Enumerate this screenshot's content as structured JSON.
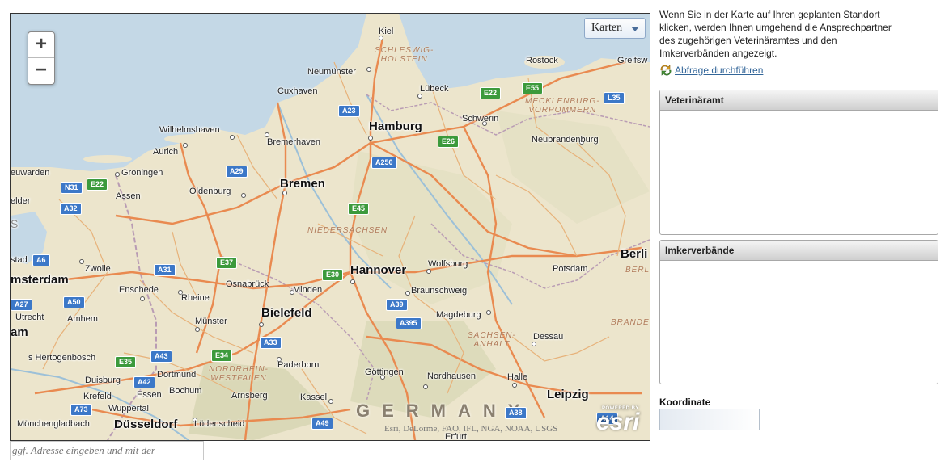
{
  "map": {
    "zoom_in": "+",
    "zoom_out": "−",
    "basemap_label": "Karten",
    "attribution": "Esri, DeLorme, FAO, IFL, NGA, NOAA, USGS",
    "logo_powered": "POWERED BY",
    "logo_name": "esri",
    "country": "GERMANY",
    "regions": [
      "SCHLESWIG-",
      "HOLSTEIN",
      "MECKLENBURG-",
      "VORPOMMERN",
      "NIEDERSACHSEN",
      "SACHSEN-",
      "ANHALT",
      "NORDRHEIN-",
      "WESTFALEN",
      "BERLIN",
      "BRANDE"
    ],
    "major_cities": [
      "Hamburg",
      "Bremen",
      "Hannover",
      "Bielefeld",
      "Düsseldorf",
      "Leipzig",
      "Berli",
      "msterdam"
    ],
    "cities": [
      "Kiel",
      "Rostock",
      "Greifsw",
      "Neumünster",
      "Lübeck",
      "Cuxhaven",
      "Schwerin",
      "Wilhelmshaven",
      "Bremerhaven",
      "Neubrandenburg",
      "Aurich",
      "euwarden",
      "Groningen",
      "Assen",
      "Oldenburg",
      "elder",
      "Zwolle",
      "Wolfsburg",
      "Potsdam",
      "Enschede",
      "Osnabrück",
      "Minden",
      "Braunschweig",
      "Rheine",
      "Magdeburg",
      "Utrecht",
      "Amhem",
      "Münster",
      "Dessau",
      "s Hertogenbosch",
      "Paderborn",
      "Dortmund",
      "Göttingen",
      "Nordhausen",
      "Halle",
      "Duisburg",
      "Essen",
      "Bochum",
      "Krefeld",
      "Arnsberg",
      "Kassel",
      "Wuppertal",
      "Mönchengladbach",
      "Lüdenscheid",
      "Erfurt",
      "stad",
      "S",
      "am"
    ],
    "roads_blue": [
      "A23",
      "A29",
      "A250",
      "N31",
      "A32",
      "A6",
      "A31",
      "A50",
      "A39",
      "A395",
      "A27",
      "A33",
      "A43",
      "A42",
      "A73",
      "A49",
      "A38",
      "A14",
      "L35"
    ],
    "roads_green": [
      "E22",
      "E55",
      "E22",
      "E26",
      "E45",
      "E37",
      "E30",
      "E35",
      "E34"
    ]
  },
  "address": {
    "placeholder": "ggf. Adresse eingeben und mit der"
  },
  "sidebar": {
    "intro": "Wenn Sie in der Karte auf Ihren geplanten Standort klicken, werden Ihnen umgehend die Ansprechpartner des zugehörigen Veterinäramtes und den Imkerverbänden angezeigt.",
    "query_link": "Abfrage durchführen",
    "vet_header": "Veterinäramt",
    "beekeeper_header": "Imkerverbände",
    "coord_label": "Koordinate",
    "coord_value": ""
  },
  "colors": {
    "land": "#ece5cc",
    "water": "#c4d8e6",
    "major_road": "#e98a50",
    "minor_road": "#e7b27a",
    "border": "#b99cb4",
    "link": "#336699"
  }
}
